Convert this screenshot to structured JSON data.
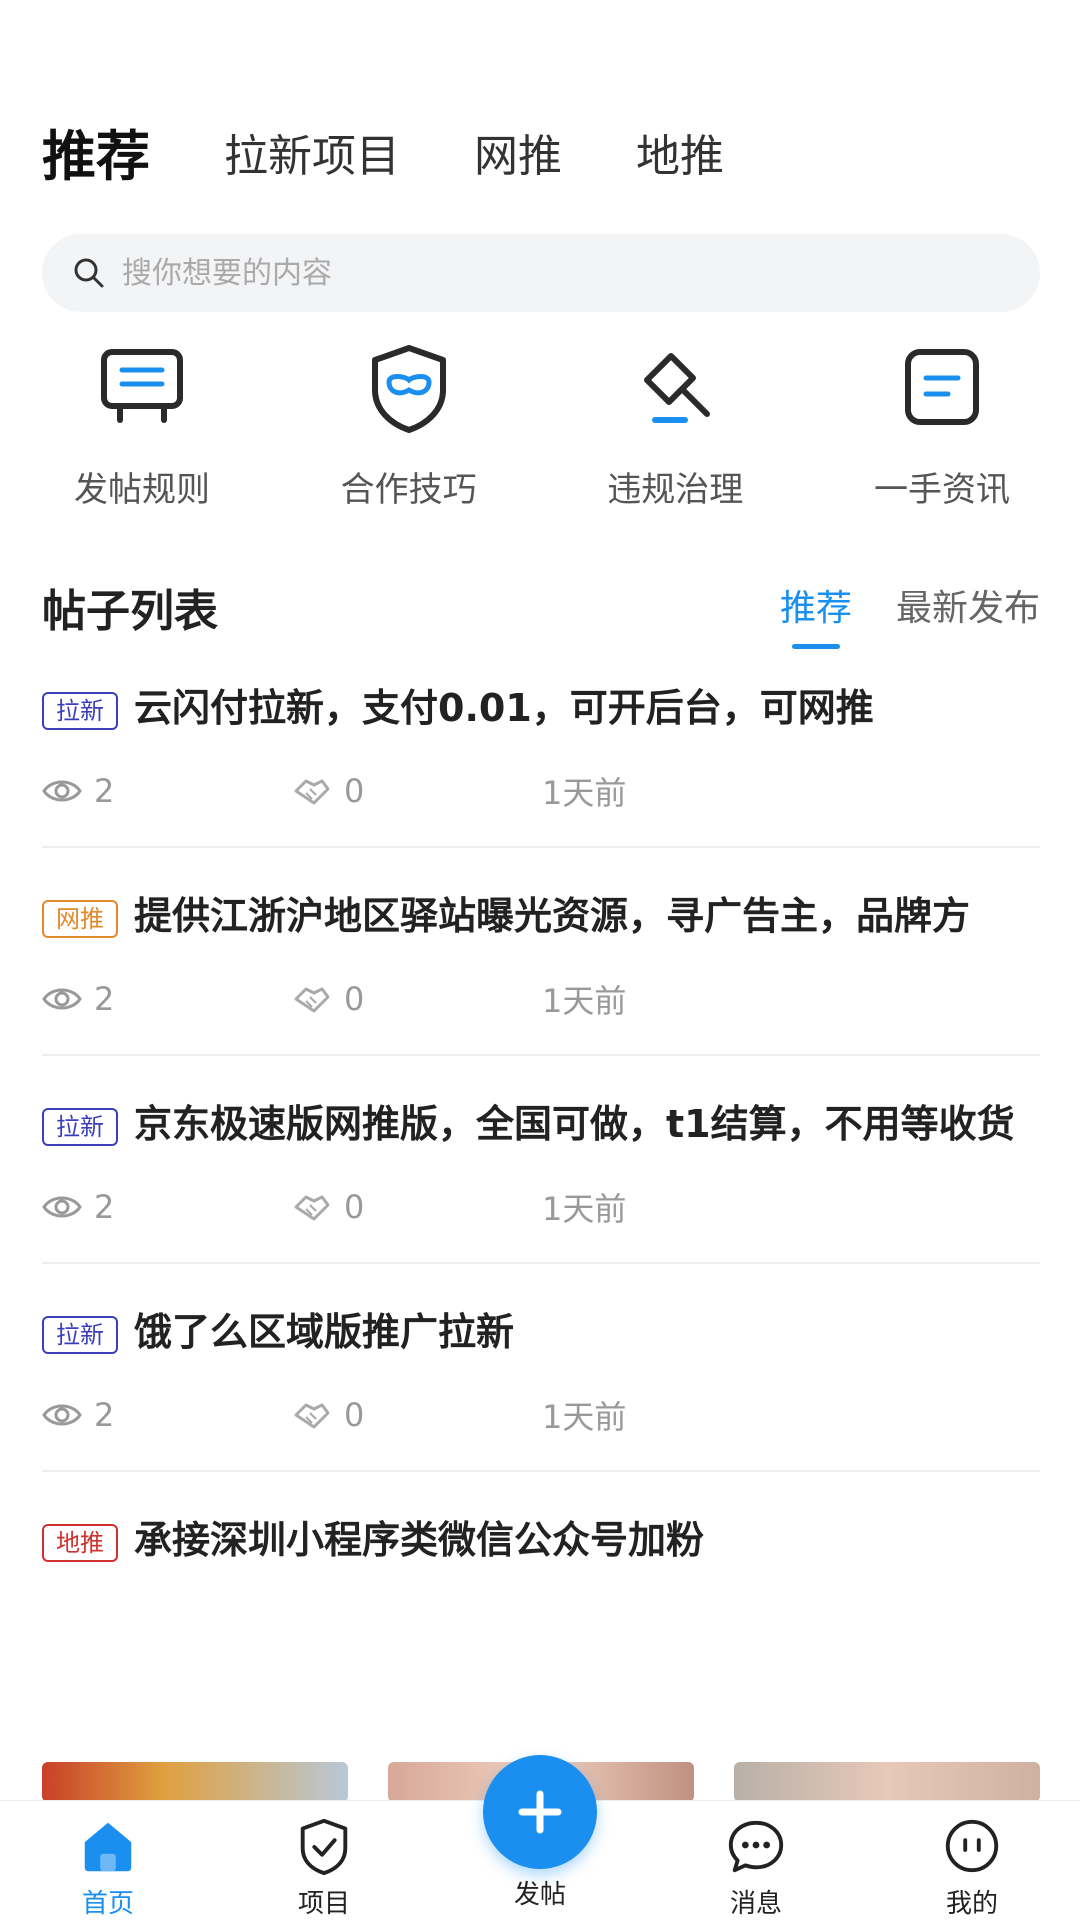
{
  "header": {
    "tabs": [
      {
        "label": "推荐",
        "active": true
      },
      {
        "label": "拉新项目",
        "active": false
      },
      {
        "label": "网推",
        "active": false
      },
      {
        "label": "地推",
        "active": false
      }
    ]
  },
  "search": {
    "placeholder": "搜你想要的内容",
    "icon": "search-icon"
  },
  "quick_links": [
    {
      "label": "发帖规则",
      "icon": "sign-board-icon"
    },
    {
      "label": "合作技巧",
      "icon": "shield-mask-icon"
    },
    {
      "label": "违规治理",
      "icon": "gavel-icon"
    },
    {
      "label": "一手资讯",
      "icon": "news-card-icon"
    }
  ],
  "post_list": {
    "title": "帖子列表",
    "sort_tabs": [
      {
        "label": "推荐",
        "active": true
      },
      {
        "label": "最新发布",
        "active": false
      }
    ],
    "posts": [
      {
        "tag": "拉新",
        "tag_color": "#3b3fb8",
        "title": "云闪付拉新，支付0.01，可开后台，可网推",
        "views": "2",
        "likes": "0",
        "time": "1天前"
      },
      {
        "tag": "网推",
        "tag_color": "#e3892b",
        "title": "提供江浙沪地区驿站曝光资源，寻广告主，品牌方",
        "views": "2",
        "likes": "0",
        "time": "1天前"
      },
      {
        "tag": "拉新",
        "tag_color": "#3b3fb8",
        "title": "京东极速版网推版，全国可做，t1结算，不用等收货",
        "views": "2",
        "likes": "0",
        "time": "1天前"
      },
      {
        "tag": "拉新",
        "tag_color": "#3b3fb8",
        "title": "饿了么区域版推广拉新",
        "views": "2",
        "likes": "0",
        "time": "1天前"
      },
      {
        "tag": "地推",
        "tag_color": "#d0312d",
        "title": "承接深圳小程序类微信公众号加粉"
      }
    ]
  },
  "bottom_nav": [
    {
      "label": "首页",
      "icon": "home-icon",
      "active": true
    },
    {
      "label": "项目",
      "icon": "project-shield-icon",
      "active": false
    },
    {
      "label": "发帖",
      "icon": "plus-icon",
      "active": false
    },
    {
      "label": "消息",
      "icon": "message-bubble-icon",
      "active": false
    },
    {
      "label": "我的",
      "icon": "profile-face-icon",
      "active": false
    }
  ],
  "colors": {
    "accent": "#1a8ff0",
    "tag_blue": "#3b3fb8",
    "tag_orange": "#e3892b",
    "tag_red": "#d0312d"
  }
}
